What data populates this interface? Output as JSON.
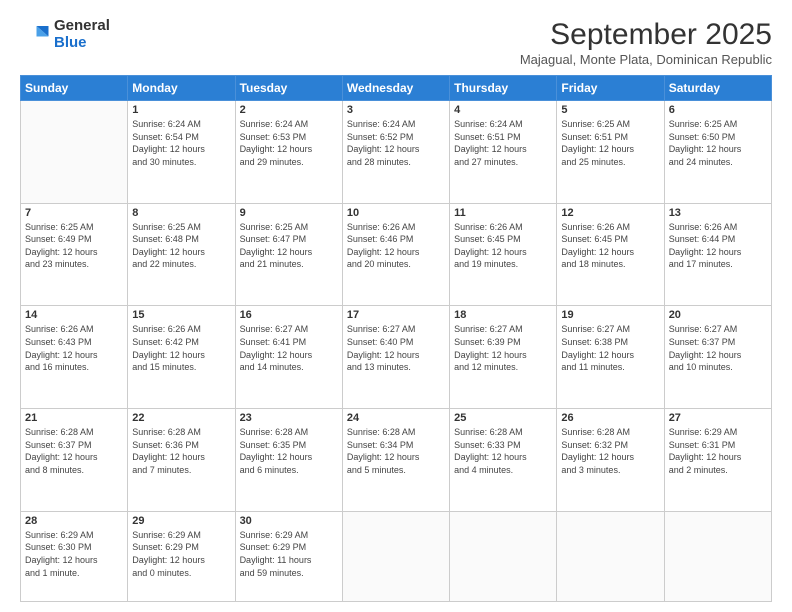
{
  "logo": {
    "general": "General",
    "blue": "Blue"
  },
  "header": {
    "month": "September 2025",
    "location": "Majagual, Monte Plata, Dominican Republic"
  },
  "weekdays": [
    "Sunday",
    "Monday",
    "Tuesday",
    "Wednesday",
    "Thursday",
    "Friday",
    "Saturday"
  ],
  "weeks": [
    [
      {
        "day": "",
        "info": ""
      },
      {
        "day": "1",
        "info": "Sunrise: 6:24 AM\nSunset: 6:54 PM\nDaylight: 12 hours\nand 30 minutes."
      },
      {
        "day": "2",
        "info": "Sunrise: 6:24 AM\nSunset: 6:53 PM\nDaylight: 12 hours\nand 29 minutes."
      },
      {
        "day": "3",
        "info": "Sunrise: 6:24 AM\nSunset: 6:52 PM\nDaylight: 12 hours\nand 28 minutes."
      },
      {
        "day": "4",
        "info": "Sunrise: 6:24 AM\nSunset: 6:51 PM\nDaylight: 12 hours\nand 27 minutes."
      },
      {
        "day": "5",
        "info": "Sunrise: 6:25 AM\nSunset: 6:51 PM\nDaylight: 12 hours\nand 25 minutes."
      },
      {
        "day": "6",
        "info": "Sunrise: 6:25 AM\nSunset: 6:50 PM\nDaylight: 12 hours\nand 24 minutes."
      }
    ],
    [
      {
        "day": "7",
        "info": "Sunrise: 6:25 AM\nSunset: 6:49 PM\nDaylight: 12 hours\nand 23 minutes."
      },
      {
        "day": "8",
        "info": "Sunrise: 6:25 AM\nSunset: 6:48 PM\nDaylight: 12 hours\nand 22 minutes."
      },
      {
        "day": "9",
        "info": "Sunrise: 6:25 AM\nSunset: 6:47 PM\nDaylight: 12 hours\nand 21 minutes."
      },
      {
        "day": "10",
        "info": "Sunrise: 6:26 AM\nSunset: 6:46 PM\nDaylight: 12 hours\nand 20 minutes."
      },
      {
        "day": "11",
        "info": "Sunrise: 6:26 AM\nSunset: 6:45 PM\nDaylight: 12 hours\nand 19 minutes."
      },
      {
        "day": "12",
        "info": "Sunrise: 6:26 AM\nSunset: 6:45 PM\nDaylight: 12 hours\nand 18 minutes."
      },
      {
        "day": "13",
        "info": "Sunrise: 6:26 AM\nSunset: 6:44 PM\nDaylight: 12 hours\nand 17 minutes."
      }
    ],
    [
      {
        "day": "14",
        "info": "Sunrise: 6:26 AM\nSunset: 6:43 PM\nDaylight: 12 hours\nand 16 minutes."
      },
      {
        "day": "15",
        "info": "Sunrise: 6:26 AM\nSunset: 6:42 PM\nDaylight: 12 hours\nand 15 minutes."
      },
      {
        "day": "16",
        "info": "Sunrise: 6:27 AM\nSunset: 6:41 PM\nDaylight: 12 hours\nand 14 minutes."
      },
      {
        "day": "17",
        "info": "Sunrise: 6:27 AM\nSunset: 6:40 PM\nDaylight: 12 hours\nand 13 minutes."
      },
      {
        "day": "18",
        "info": "Sunrise: 6:27 AM\nSunset: 6:39 PM\nDaylight: 12 hours\nand 12 minutes."
      },
      {
        "day": "19",
        "info": "Sunrise: 6:27 AM\nSunset: 6:38 PM\nDaylight: 12 hours\nand 11 minutes."
      },
      {
        "day": "20",
        "info": "Sunrise: 6:27 AM\nSunset: 6:37 PM\nDaylight: 12 hours\nand 10 minutes."
      }
    ],
    [
      {
        "day": "21",
        "info": "Sunrise: 6:28 AM\nSunset: 6:37 PM\nDaylight: 12 hours\nand 8 minutes."
      },
      {
        "day": "22",
        "info": "Sunrise: 6:28 AM\nSunset: 6:36 PM\nDaylight: 12 hours\nand 7 minutes."
      },
      {
        "day": "23",
        "info": "Sunrise: 6:28 AM\nSunset: 6:35 PM\nDaylight: 12 hours\nand 6 minutes."
      },
      {
        "day": "24",
        "info": "Sunrise: 6:28 AM\nSunset: 6:34 PM\nDaylight: 12 hours\nand 5 minutes."
      },
      {
        "day": "25",
        "info": "Sunrise: 6:28 AM\nSunset: 6:33 PM\nDaylight: 12 hours\nand 4 minutes."
      },
      {
        "day": "26",
        "info": "Sunrise: 6:28 AM\nSunset: 6:32 PM\nDaylight: 12 hours\nand 3 minutes."
      },
      {
        "day": "27",
        "info": "Sunrise: 6:29 AM\nSunset: 6:31 PM\nDaylight: 12 hours\nand 2 minutes."
      }
    ],
    [
      {
        "day": "28",
        "info": "Sunrise: 6:29 AM\nSunset: 6:30 PM\nDaylight: 12 hours\nand 1 minute."
      },
      {
        "day": "29",
        "info": "Sunrise: 6:29 AM\nSunset: 6:29 PM\nDaylight: 12 hours\nand 0 minutes."
      },
      {
        "day": "30",
        "info": "Sunrise: 6:29 AM\nSunset: 6:29 PM\nDaylight: 11 hours\nand 59 minutes."
      },
      {
        "day": "",
        "info": ""
      },
      {
        "day": "",
        "info": ""
      },
      {
        "day": "",
        "info": ""
      },
      {
        "day": "",
        "info": ""
      }
    ]
  ]
}
